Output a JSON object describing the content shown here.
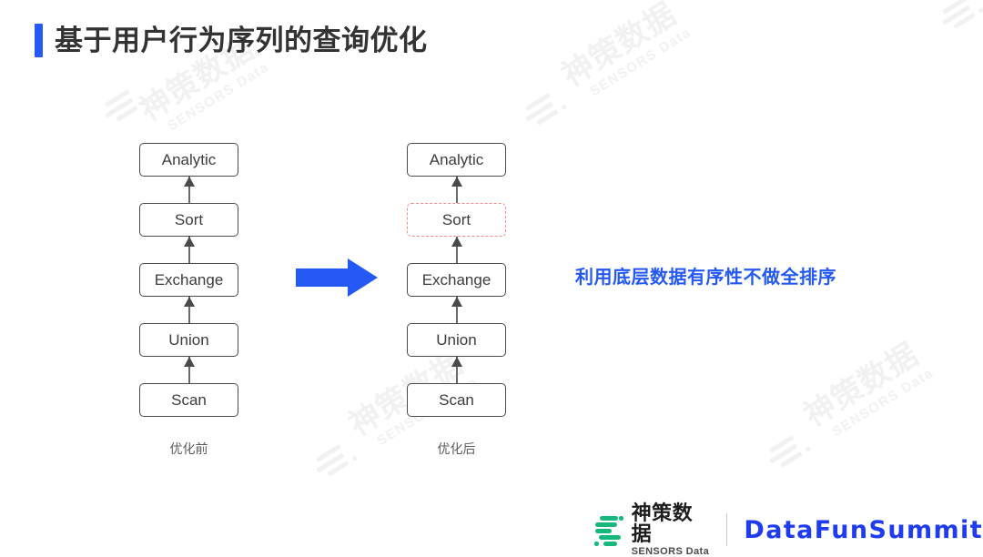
{
  "slide": {
    "title": "基于用户行为序列的查询优化",
    "accent_color": "#2559f5"
  },
  "diagram": {
    "before": {
      "caption": "优化前",
      "nodes": [
        {
          "label": "Analytic",
          "style": "solid"
        },
        {
          "label": "Sort",
          "style": "solid"
        },
        {
          "label": "Exchange",
          "style": "solid"
        },
        {
          "label": "Union",
          "style": "solid"
        },
        {
          "label": "Scan",
          "style": "solid"
        }
      ]
    },
    "after": {
      "caption": "优化后",
      "nodes": [
        {
          "label": "Analytic",
          "style": "solid"
        },
        {
          "label": "Sort",
          "style": "dashed-red"
        },
        {
          "label": "Exchange",
          "style": "solid"
        },
        {
          "label": "Union",
          "style": "solid"
        },
        {
          "label": "Scan",
          "style": "solid"
        }
      ]
    },
    "transition_arrow": {
      "icon": "right-arrow-icon",
      "color": "#2559f5"
    },
    "node_border_color": "#4a4a4a",
    "removed_node_color": "#f58a86"
  },
  "annotation": {
    "text": "利用底层数据有序性不做全排序",
    "color": "#2559f5"
  },
  "footer": {
    "sensors": {
      "cn": "神策数据",
      "en": "SENSORS Data",
      "mark_color": "#16b97b"
    },
    "conference": "DataFunSummit"
  },
  "watermark": {
    "cn": "神策数据",
    "en": "SENSORS Data",
    "color": "#f1f1f2"
  }
}
